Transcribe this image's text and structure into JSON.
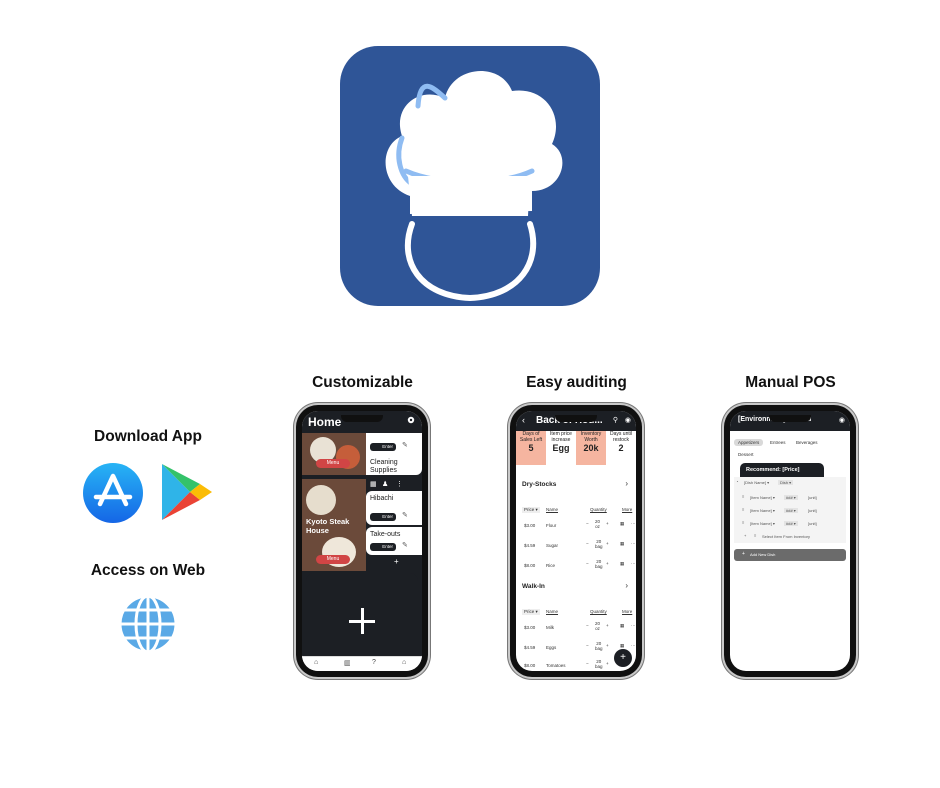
{
  "columns": {
    "customizable": "Customizable",
    "auditing": "Easy auditing",
    "pos": "Manual POS"
  },
  "left": {
    "download_title": "Download App",
    "web_title": "Access on Web"
  },
  "colors": {
    "brand": "#2f5597",
    "dark": "#1c1f24",
    "salmon": "#f5b5a0",
    "red": "#d14545"
  },
  "phone1": {
    "title": "Home",
    "tiles": [
      {
        "card1": "Cleaning Supplies",
        "menu": "Menu",
        "enter": "Enter"
      },
      {
        "name": "Kyoto Steak House",
        "card1": "Hibachi",
        "card2": "Take-outs",
        "menu": "Menu",
        "enter": "Enter"
      }
    ],
    "plus": "+"
  },
  "phone2": {
    "title": "Back of Hou...",
    "stats": [
      {
        "label": "Days of Sales Left",
        "value": "5"
      },
      {
        "label": "Item price increase",
        "value": "Egg"
      },
      {
        "label": "Inventory Worth",
        "value": "20k"
      },
      {
        "label": "Days until restock",
        "value": "2"
      }
    ],
    "sections": [
      {
        "name": "Dry-Stocks",
        "rows": [
          {
            "price": "$3.00",
            "name": "Flour",
            "qty": "20",
            "unit": "oz"
          },
          {
            "price": "$4.59",
            "name": "Sugar",
            "qty": "20",
            "unit": "bag"
          },
          {
            "price": "$8.00",
            "name": "Rice",
            "qty": "20",
            "unit": "bag"
          }
        ]
      },
      {
        "name": "Walk-In",
        "rows": [
          {
            "price": "$3.00",
            "name": "Milk",
            "qty": "20",
            "unit": "oz"
          },
          {
            "price": "$4.59",
            "name": "Eggs",
            "qty": "20",
            "unit": "bag"
          },
          {
            "price": "$8.00",
            "name": "Tomatoes",
            "qty": "20",
            "unit": "bag"
          }
        ]
      }
    ],
    "headers": {
      "price": "Price ▾",
      "name": "Name",
      "qty": "Quantity",
      "more": "More"
    }
  },
  "phone3": {
    "title": "[Environment]'s Menu",
    "tabs": [
      "Appetizers",
      "Entrees",
      "Beverages",
      "Dessert"
    ],
    "recommend": "Recommend: [Price]",
    "dish_name": "[Dish Name] ▾",
    "dish_tag": "Dish ▾",
    "items": [
      {
        "name": "[Item Name] ▾",
        "amt": "### ▾",
        "unit": "[unit]"
      },
      {
        "name": "[Item Name] ▾",
        "amt": "### ▾",
        "unit": "[unit]"
      },
      {
        "name": "[Item Name] ▾",
        "amt": "### ▾",
        "unit": "[unit]"
      }
    ],
    "select_item": "Select Item From Inventory",
    "add_dish": "Add New Dish"
  }
}
